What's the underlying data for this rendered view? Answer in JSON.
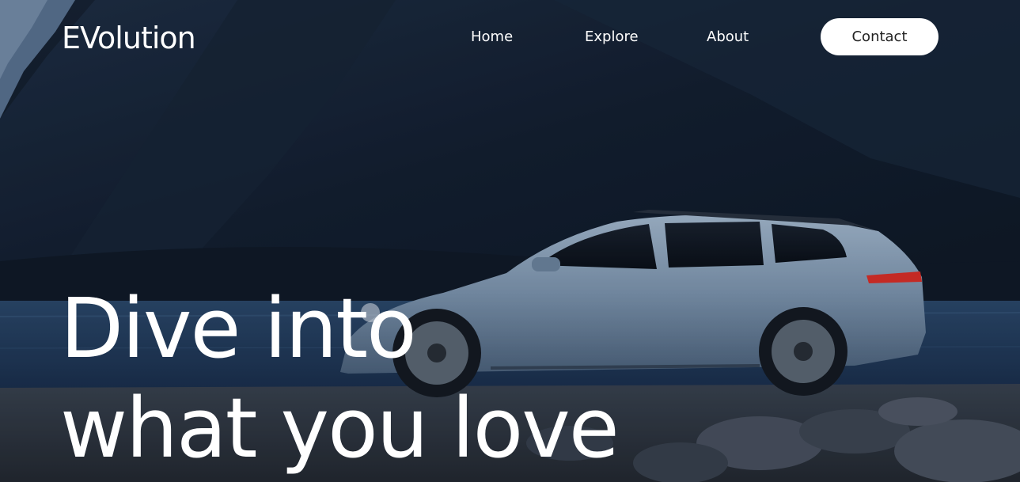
{
  "brand": {
    "logo_text": "EVolution"
  },
  "nav": {
    "items": [
      {
        "label": "Home"
      },
      {
        "label": "Explore"
      },
      {
        "label": "About"
      }
    ],
    "contact_label": "Contact"
  },
  "hero": {
    "headline_line1": "Dive into",
    "headline_line2": "what you love",
    "background_image": "blue-wagon-car-by-fjord-at-dusk"
  },
  "colors": {
    "text": "#ffffff",
    "button_bg": "#ffffff",
    "button_text": "#222222",
    "sky_dark": "#0e1a2b",
    "car_body": "#8fa7c2",
    "tail_light": "#e0302a"
  }
}
